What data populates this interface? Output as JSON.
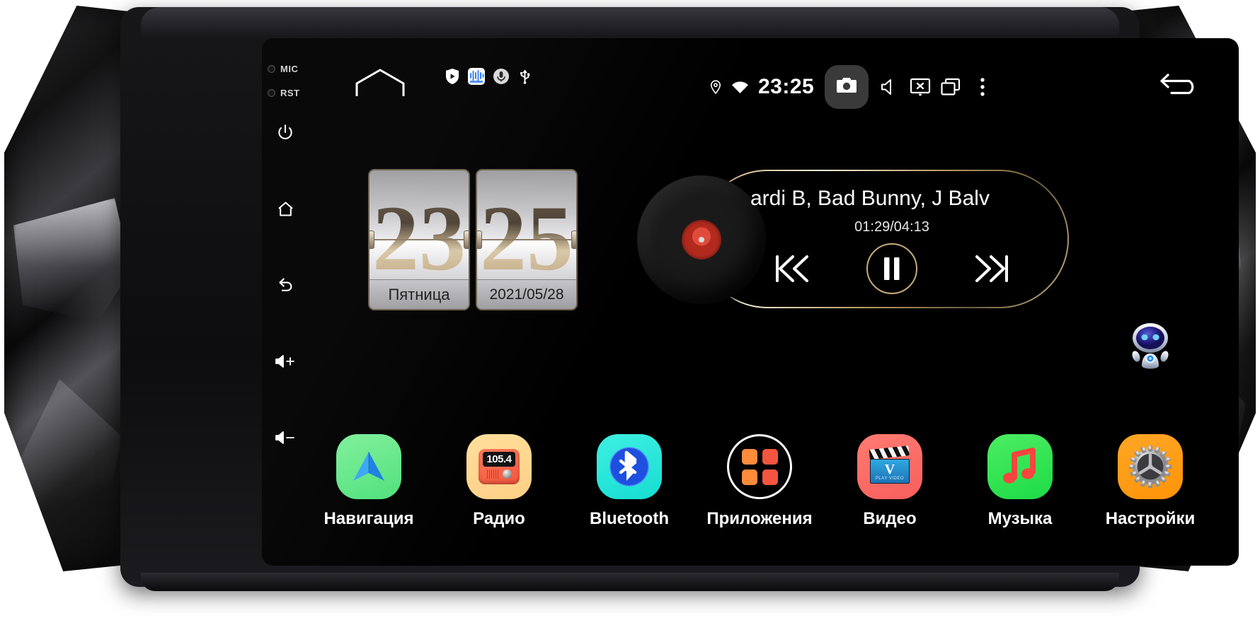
{
  "device": {
    "indicators": [
      {
        "label": "MIC",
        "name": "mic-indicator"
      },
      {
        "label": "RST",
        "name": "reset-indicator"
      }
    ],
    "hard_keys": [
      {
        "name": "power-button",
        "icon": "power-icon"
      },
      {
        "name": "home-button",
        "icon": "home-icon"
      },
      {
        "name": "back-button",
        "icon": "back-arrow-icon"
      },
      {
        "name": "volume-up-button",
        "icon": "volume-up-icon",
        "label": "+"
      },
      {
        "name": "volume-down-button",
        "icon": "volume-down-icon",
        "label": "−"
      }
    ]
  },
  "statusbar": {
    "home_arch_icon": "home-arch-icon",
    "notification_icons": [
      {
        "name": "shield-play-icon"
      },
      {
        "name": "audio-waveform-app-icon"
      },
      {
        "name": "microphone-icon"
      },
      {
        "name": "usb-icon"
      }
    ],
    "location_icon": "location-pin-icon",
    "wifi_icon": "wifi-icon",
    "time": "23:25",
    "camera_button": {
      "name": "camera-button",
      "icon": "camera-icon"
    },
    "volume_icon": "volume-mute-icon",
    "screen_off_icon": "screen-off-icon",
    "recents_icon": "recent-apps-icon",
    "overflow_icon": "kebab-menu-icon",
    "back_icon": "back-u-turn-icon"
  },
  "clock_widget": {
    "hours": "23",
    "minutes": "25",
    "weekday": "Пятница",
    "date": "2021/05/28"
  },
  "music_widget": {
    "track_title": "ardi B, Bad Bunny, J Balv",
    "elapsed_total": "01:29/04:13",
    "controls": [
      {
        "name": "previous-track-button",
        "icon": "skip-previous-icon"
      },
      {
        "name": "play-pause-button",
        "icon": "pause-icon"
      },
      {
        "name": "next-track-button",
        "icon": "skip-next-icon"
      }
    ],
    "accent_color": "#c9a873"
  },
  "assistant": {
    "name": "voice-assistant-robot",
    "icon": "robot-assistant-icon"
  },
  "dock": {
    "apps": [
      {
        "label": "Навигация",
        "name": "app-navigation",
        "icon": "navigation-arrow-icon",
        "color": "#4fe07b"
      },
      {
        "label": "Радио",
        "name": "app-radio",
        "icon": "radio-icon",
        "color": "#ffcf86",
        "frequency": "105.4"
      },
      {
        "label": "Bluetooth",
        "name": "app-bluetooth",
        "icon": "bluetooth-icon",
        "color": "#16ddd2"
      },
      {
        "label": "Приложения",
        "name": "app-applications",
        "icon": "apps-grid-icon",
        "color": "#ffffff"
      },
      {
        "label": "Видео",
        "name": "app-video",
        "icon": "clapperboard-icon",
        "color": "#f85f5c",
        "badge": "V",
        "badge_sub": "PLAY VIDEO"
      },
      {
        "label": "Музыка",
        "name": "app-music",
        "icon": "music-note-icon",
        "color": "#1ddb46"
      },
      {
        "label": "Настройки",
        "name": "app-settings",
        "icon": "gear-icon",
        "color": "#ff9307"
      }
    ]
  }
}
